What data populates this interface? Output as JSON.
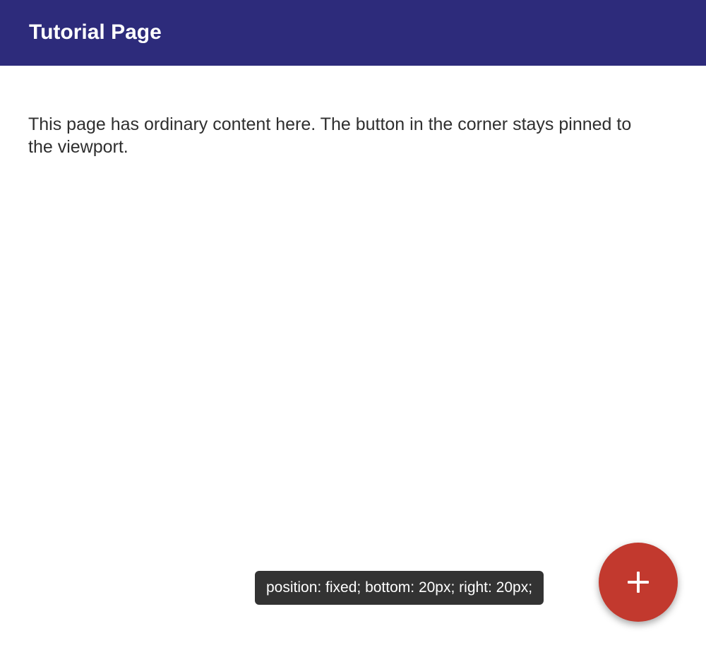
{
  "header": {
    "title": "Tutorial Page",
    "background_color": "#2d2b7b"
  },
  "main": {
    "text": "This page has ordinary content here. The button in the corner stays pinned to the viewport."
  },
  "tooltip": {
    "text": "position: fixed; bottom: 20px; right: 20px;"
  },
  "fab": {
    "icon": "plus-icon",
    "color": "#c2392e"
  }
}
